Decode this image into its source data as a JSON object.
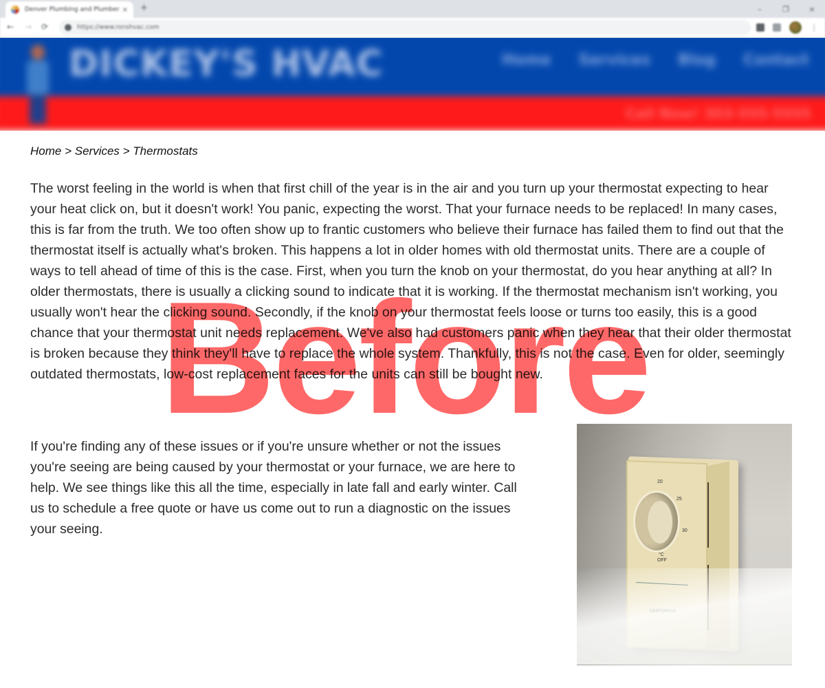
{
  "browser": {
    "tab_title": "Denver Plumbing and Plumber...",
    "tab_close": "×",
    "new_tab": "+",
    "url": "https://www.ronshvac.com",
    "window_controls": {
      "minimize": "–",
      "restore": "❐",
      "close": "×"
    },
    "nav": {
      "back": "←",
      "forward": "→",
      "reload": "⟳"
    },
    "menu": "⋮"
  },
  "site": {
    "logo_text": "DICKEY'S HVAC",
    "nav": [
      {
        "label": "Home"
      },
      {
        "label": "Services"
      },
      {
        "label": "Blog"
      },
      {
        "label": "Contact"
      }
    ],
    "phone_bar": "Call Now! 303-555-5555",
    "colors": {
      "header_blue": "#0347ad",
      "header_red": "#fe1a1a"
    }
  },
  "breadcrumb": {
    "items": [
      "Home",
      "Services",
      "Thermostats"
    ],
    "separator": " > ",
    "text": "Home > Services > Thermostats"
  },
  "content": {
    "paragraph1": "The worst feeling in the world is when that first chill of the year is in the air and you turn up your thermostat expecting to hear your heat click on, but it doesn't work! You panic, expecting the worst. That your furnace needs to be replaced! In many cases, this is far from the truth. We too often show up to frantic customers who believe their furnace has failed them to find out that the thermostat itself is actually what's broken. This happens a lot in older homes with old thermostat units. There are a couple of ways to tell ahead of time of this is the case. First, when you turn the knob on your thermostat, do you hear anything at all? In older thermostats, there is usually a clicking sound to indicate that it is working. If the thermostat mechanism isn't working, you usually won't hear the clicking sound. Secondly, if the knob on your thermostat feels loose or turns too easily, this is a good chance that your thermostat unit needs replacement. We've also had customers panic when they hear that their older thermostat is broken because they think they'll have to replace the whole system. Thankfully, this is not the case. Even for older, seemingly outdated thermostats, low-cost replacement faces for the units can still be bought new.",
    "paragraph2": "If you're finding any of these issues or if you're unsure whether or not the issues you're seeing are being caused by your thermostat or your furnace, we are here to help. We see things like this all the time, especially in late fall and early winter. Call us to schedule a free quote or have us come out to run a diagnostic on the issues your seeing."
  },
  "photo": {
    "subject": "thermostat",
    "dial_labels": [
      "20",
      "25",
      "30",
      "°C",
      "OFF"
    ],
    "brand": "CENTURION"
  },
  "watermark": {
    "text": "Before",
    "color": "#ff4d4d"
  }
}
